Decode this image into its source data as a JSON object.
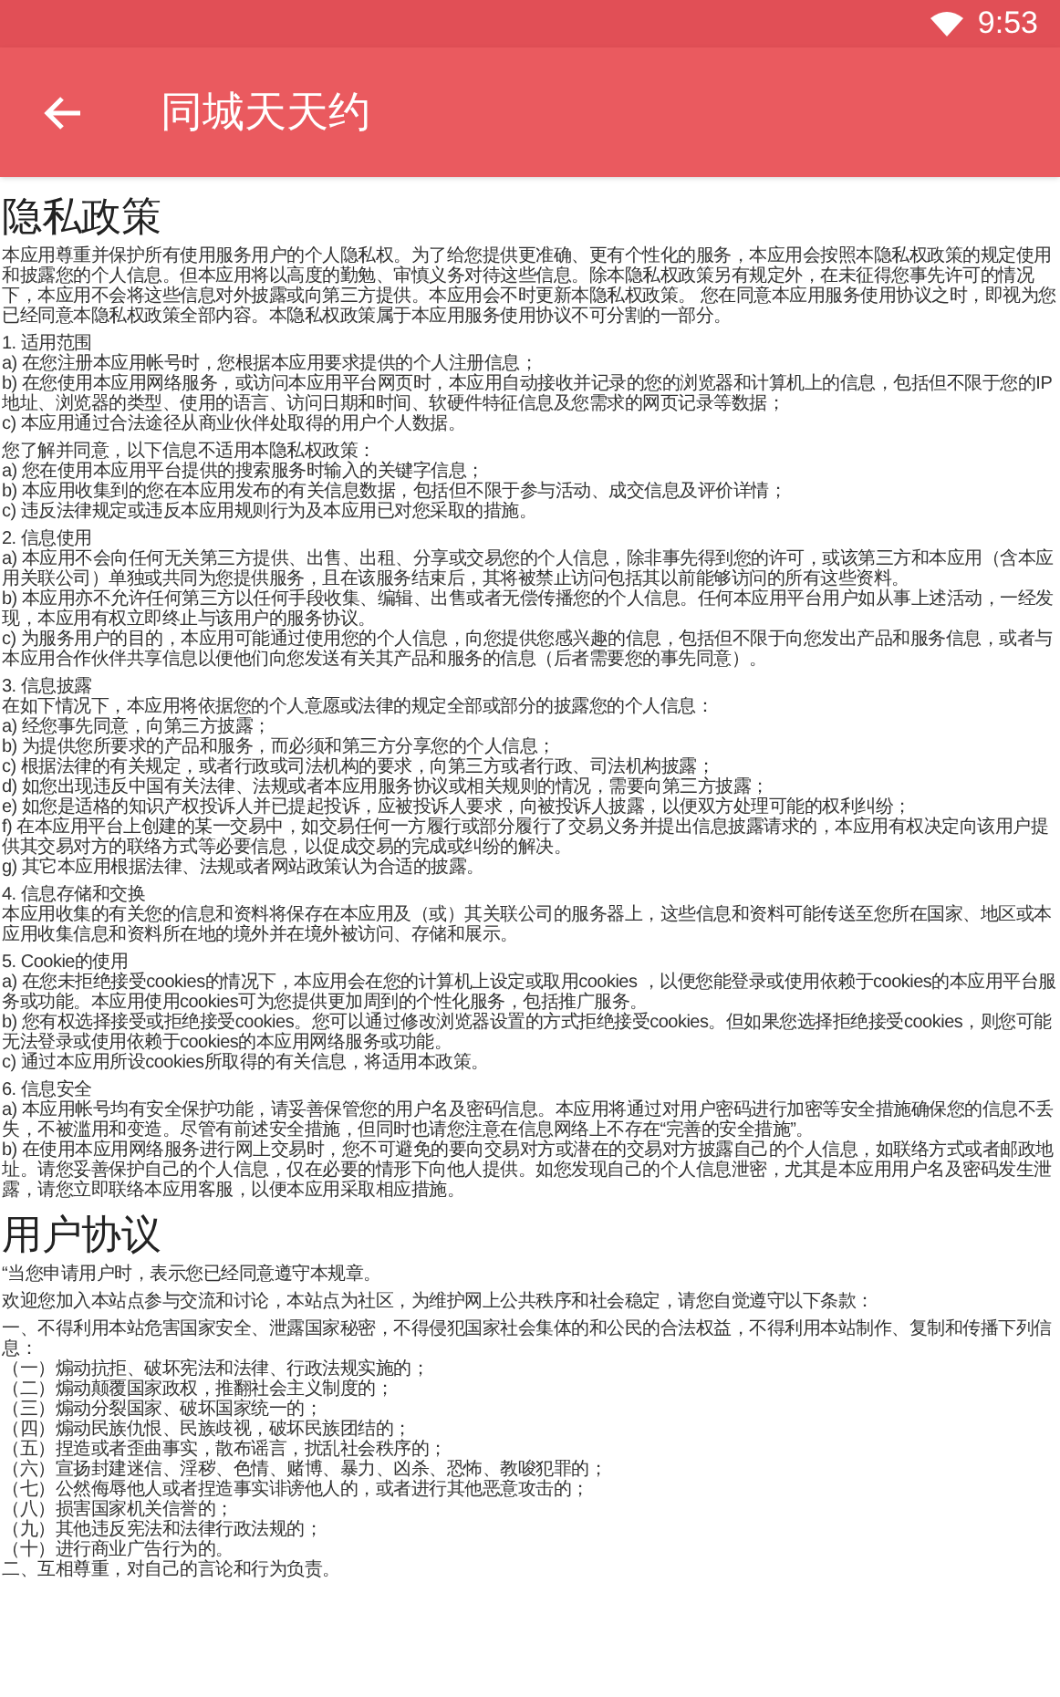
{
  "status_bar": {
    "time": "9:53"
  },
  "app_bar": {
    "title": "同城天天约"
  },
  "sections": [
    {
      "heading": "隐私政策",
      "blocks": [
        [
          "本应用尊重并保护所有使用服务用户的个人隐私权。为了给您提供更准确、更有个性化的服务，本应用会按照本隐私权政策的规定使用和披露您的个人信息。但本应用将以高度的勤勉、审慎义务对待这些信息。除本隐私权政策另有规定外，在未征得您事先许可的情况下，本应用不会将这些信息对外披露或向第三方提供。本应用会不时更新本隐私权政策。 您在同意本应用服务使用协议之时，即视为您已经同意本隐私权政策全部内容。本隐私权政策属于本应用服务使用协议不可分割的一部分。"
        ],
        [
          "1. 适用范围",
          "a) 在您注册本应用帐号时，您根据本应用要求提供的个人注册信息；",
          "b) 在您使用本应用网络服务，或访问本应用平台网页时，本应用自动接收并记录的您的浏览器和计算机上的信息，包括但不限于您的IP地址、浏览器的类型、使用的语言、访问日期和时间、软硬件特征信息及您需求的网页记录等数据；",
          "c) 本应用通过合法途径从商业伙伴处取得的用户个人数据。"
        ],
        [
          "您了解并同意，以下信息不适用本隐私权政策：",
          "a) 您在使用本应用平台提供的搜索服务时输入的关键字信息；",
          "b) 本应用收集到的您在本应用发布的有关信息数据，包括但不限于参与活动、成交信息及评价详情；",
          "c) 违反法律规定或违反本应用规则行为及本应用已对您采取的措施。"
        ],
        [
          "2. 信息使用",
          "a) 本应用不会向任何无关第三方提供、出售、出租、分享或交易您的个人信息，除非事先得到您的许可，或该第三方和本应用（含本应用关联公司）单独或共同为您提供服务，且在该服务结束后，其将被禁止访问包括其以前能够访问的所有这些资料。",
          "b) 本应用亦不允许任何第三方以任何手段收集、编辑、出售或者无偿传播您的个人信息。任何本应用平台用户如从事上述活动，一经发现，本应用有权立即终止与该用户的服务协议。",
          "c) 为服务用户的目的，本应用可能通过使用您的个人信息，向您提供您感兴趣的信息，包括但不限于向您发出产品和服务信息，或者与本应用合作伙伴共享信息以便他们向您发送有关其产品和服务的信息（后者需要您的事先同意）。"
        ],
        [
          "3. 信息披露",
          "在如下情况下，本应用将依据您的个人意愿或法律的规定全部或部分的披露您的个人信息：",
          "a) 经您事先同意，向第三方披露；",
          "b) 为提供您所要求的产品和服务，而必须和第三方分享您的个人信息；",
          "c) 根据法律的有关规定，或者行政或司法机构的要求，向第三方或者行政、司法机构披露；",
          "d) 如您出现违反中国有关法律、法规或者本应用服务协议或相关规则的情况，需要向第三方披露；",
          "e) 如您是适格的知识产权投诉人并已提起投诉，应被投诉人要求，向被投诉人披露，以便双方处理可能的权利纠纷；",
          "f) 在本应用平台上创建的某一交易中，如交易任何一方履行或部分履行了交易义务并提出信息披露请求的，本应用有权决定向该用户提供其交易对方的联络方式等必要信息，以促成交易的完成或纠纷的解决。",
          "g) 其它本应用根据法律、法规或者网站政策认为合适的披露。"
        ],
        [
          "4. 信息存储和交换",
          "本应用收集的有关您的信息和资料将保存在本应用及（或）其关联公司的服务器上，这些信息和资料可能传送至您所在国家、地区或本应用收集信息和资料所在地的境外并在境外被访问、存储和展示。"
        ],
        [
          "5. Cookie的使用",
          "a) 在您未拒绝接受cookies的情况下，本应用会在您的计算机上设定或取用cookies ，以便您能登录或使用依赖于cookies的本应用平台服务或功能。本应用使用cookies可为您提供更加周到的个性化服务，包括推广服务。",
          "b) 您有权选择接受或拒绝接受cookies。您可以通过修改浏览器设置的方式拒绝接受cookies。但如果您选择拒绝接受cookies，则您可能无法登录或使用依赖于cookies的本应用网络服务或功能。",
          "c) 通过本应用所设cookies所取得的有关信息，将适用本政策。"
        ],
        [
          "6. 信息安全",
          "a) 本应用帐号均有安全保护功能，请妥善保管您的用户名及密码信息。本应用将通过对用户密码进行加密等安全措施确保您的信息不丢失，不被滥用和变造。尽管有前述安全措施，但同时也请您注意在信息网络上不存在“完善的安全措施”。",
          "b) 在使用本应用网络服务进行网上交易时，您不可避免的要向交易对方或潜在的交易对方披露自己的个人信息，如联络方式或者邮政地址。请您妥善保护自己的个人信息，仅在必要的情形下向他人提供。如您发现自己的个人信息泄密，尤其是本应用用户名及密码发生泄露，请您立即联络本应用客服，以便本应用采取相应措施。"
        ]
      ]
    },
    {
      "heading": "用户协议",
      "blocks": [
        [
          "“当您申请用户时，表示您已经同意遵守本规章。"
        ],
        [
          "欢迎您加入本站点参与交流和讨论，本站点为社区，为维护网上公共秩序和社会稳定，请您自觉遵守以下条款："
        ],
        [
          "一、不得利用本站危害国家安全、泄露国家秘密，不得侵犯国家社会集体的和公民的合法权益，不得利用本站制作、复制和传播下列信息：",
          "（一）煽动抗拒、破坏宪法和法律、行政法规实施的；",
          "（二）煽动颠覆国家政权，推翻社会主义制度的；",
          "（三）煽动分裂国家、破坏国家统一的；",
          "（四）煽动民族仇恨、民族歧视，破坏民族团结的；",
          "（五）捏造或者歪曲事实，散布谣言，扰乱社会秩序的；",
          "（六）宣扬封建迷信、淫秽、色情、赌博、暴力、凶杀、恐怖、教唆犯罪的；",
          "（七）公然侮辱他人或者捏造事实诽谤他人的，或者进行其他恶意攻击的；",
          "（八）损害国家机关信誉的；",
          "（九）其他违反宪法和法律行政法规的；",
          "（十）进行商业广告行为的。",
          "二、互相尊重，对自己的言论和行为负责。"
        ]
      ]
    }
  ]
}
